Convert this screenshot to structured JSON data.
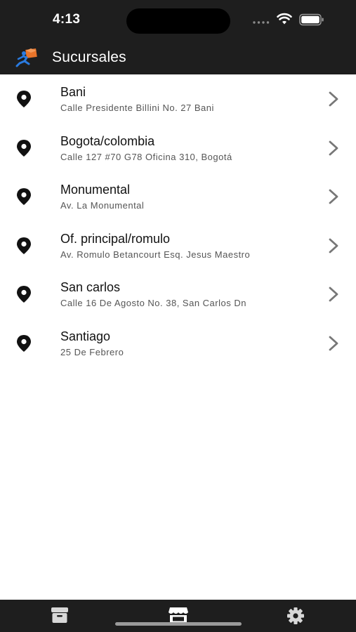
{
  "status_bar": {
    "time": "4:13",
    "icons": [
      "signal-icon",
      "wifi-icon",
      "battery-icon"
    ]
  },
  "header": {
    "title": "Sucursales",
    "logo_icon": "delivery-logo-icon",
    "background": "#1e1e1e"
  },
  "branches": [
    {
      "name": "Bani",
      "address": "Calle Presidente Billini No. 27 Bani"
    },
    {
      "name": "Bogota/colombia",
      "address": "Calle 127 #70 G78 Oficina 310, Bogotá"
    },
    {
      "name": "Monumental",
      "address": "Av. La Monumental"
    },
    {
      "name": "Of. principal/romulo",
      "address": "Av. Romulo Betancourt Esq. Jesus Maestro"
    },
    {
      "name": "San carlos",
      "address": "Calle 16 De Agosto No. 38, San Carlos Dn"
    },
    {
      "name": "Santiago",
      "address": "25 De Febrero"
    }
  ],
  "list_icons": {
    "leading": "map-pin-icon",
    "trailing": "chevron-right-icon"
  },
  "tab_bar": {
    "tabs": [
      {
        "icon": "package-icon",
        "active": false
      },
      {
        "icon": "store-icon",
        "active": true
      },
      {
        "icon": "gear-icon",
        "active": false
      }
    ],
    "background": "#1e1e1e"
  },
  "colors": {
    "bar_background": "#1e1e1e",
    "list_background": "#ffffff",
    "title_text": "#111111",
    "subtitle_text": "#555555",
    "chevron": "#777777",
    "logo_orange": "#e8742a",
    "logo_blue": "#2a7be0"
  }
}
